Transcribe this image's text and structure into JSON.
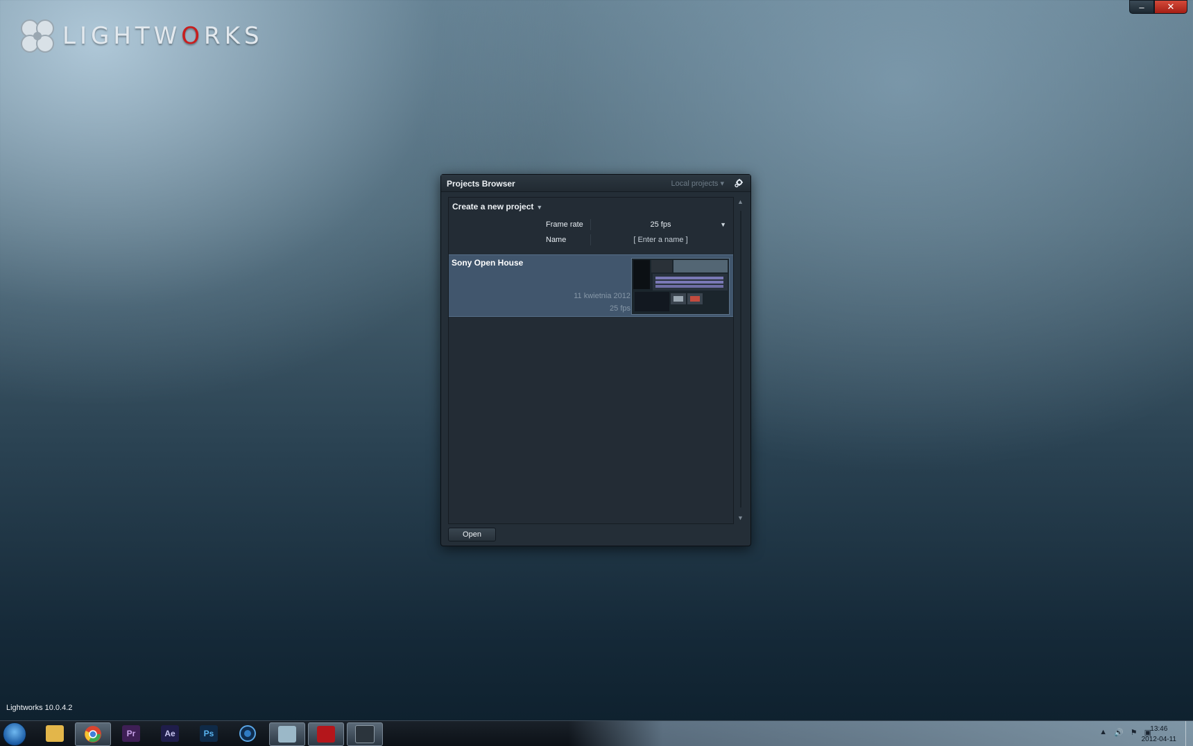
{
  "app": {
    "logo_text_start": "LIGHTW",
    "logo_text_red": "O",
    "logo_text_end": "RKS",
    "version": "Lightworks 10.0.4.2"
  },
  "window_controls": {
    "minimize": "–",
    "close": "✕"
  },
  "panel": {
    "title": "Projects Browser",
    "source_select": "Local projects ▾",
    "create": {
      "title": "Create a new project",
      "caret": "▼",
      "frame_rate_label": "Frame rate",
      "frame_rate_value": "25 fps",
      "frame_rate_caret": "▼",
      "name_label": "Name",
      "name_placeholder": "[ Enter a name ]"
    },
    "projects": [
      {
        "name": "Sony Open House",
        "date": "11 kwietnia 2012",
        "fps": "25 fps"
      }
    ],
    "scroll_up": "▲",
    "scroll_down": "▼",
    "open_label": "Open"
  },
  "taskbar": {
    "apps": [
      {
        "name": "explorer",
        "glyph": "",
        "color": "#e3b64a"
      },
      {
        "name": "chrome",
        "glyph": "",
        "color": "#d9442f"
      },
      {
        "name": "premiere",
        "glyph": "Pr",
        "color": "#3e1f55"
      },
      {
        "name": "after-effects",
        "glyph": "Ae",
        "color": "#1f1d4a"
      },
      {
        "name": "photoshop",
        "glyph": "Ps",
        "color": "#0f2a47"
      },
      {
        "name": "camera",
        "glyph": "",
        "color": "#1a4e82"
      },
      {
        "name": "notes",
        "glyph": "",
        "color": "#9bb8c8"
      },
      {
        "name": "acrobat",
        "glyph": "",
        "color": "#b4161b"
      },
      {
        "name": "lightworks",
        "glyph": "",
        "color": "#2b343c"
      }
    ],
    "tray_up": "▲",
    "tray_volume": "🔊",
    "clock_time": "13:46",
    "clock_date": "2012-04-11"
  },
  "colors": {
    "accent_red": "#c81e1e",
    "selection": "#41566d",
    "panel_bg": "#242e37"
  }
}
